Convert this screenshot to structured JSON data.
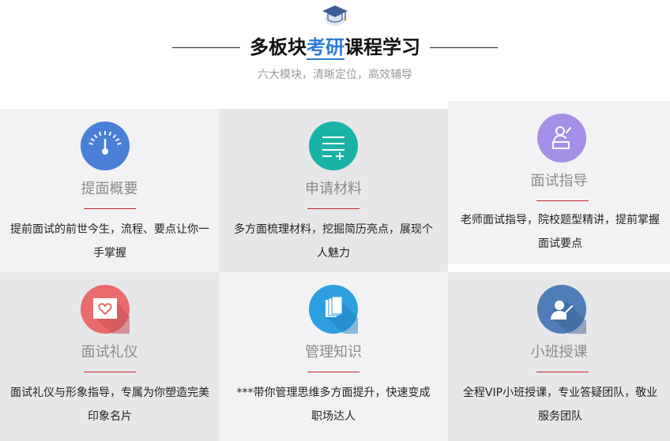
{
  "header": {
    "title_before": "多板块",
    "title_highlight": "考研",
    "title_after": "课程学习",
    "subtitle": "六大模块，清晰定位，高效辅导"
  },
  "colors": {
    "highlight": "#2d7dd2",
    "divider": "#c9242a",
    "card_light": "#f2f2f4",
    "card_dark": "#e7e7e9"
  },
  "modules": [
    {
      "title": "提面概要",
      "desc": "提前面试的前世今生，流程、要点让你一手掌握",
      "icon": "gauge-icon",
      "color": "#4a7fd6"
    },
    {
      "title": "申请材料",
      "desc": "多方面梳理材料，挖掘简历亮点，展现个人魅力",
      "icon": "list-plus-icon",
      "color": "#19b3a6"
    },
    {
      "title": "面试指导",
      "desc": "老师面试指导，院校题型精讲，提前掌握面试要点",
      "icon": "teacher-icon",
      "color": "#a58ee8"
    },
    {
      "title": "面试礼仪",
      "desc": "面试礼仪与形象指导，专属为你塑造完美印象名片",
      "icon": "heart-card-icon",
      "color": "#e86c6c"
    },
    {
      "title": "管理知识",
      "desc": "***带你管理思维多方面提升，快速变成职场达人",
      "icon": "books-icon",
      "color": "#2d9fe0"
    },
    {
      "title": "小班授课",
      "desc": "全程VIP小班授课，专业答疑团队，敬业服务团队",
      "icon": "lecturer-icon",
      "color": "#4f7db7"
    }
  ]
}
